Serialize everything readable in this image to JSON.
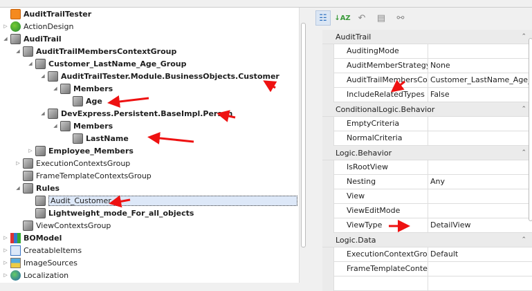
{
  "tree": {
    "nodes": [
      {
        "label": "AuditTrailTester",
        "bold": true,
        "level": 0,
        "toggle": "",
        "icon": "app-icon"
      },
      {
        "label": "ActionDesign",
        "bold": false,
        "level": 0,
        "toggle": "collapsed",
        "icon": "action-design-icon"
      },
      {
        "label": "AudiTrail",
        "bold": true,
        "level": 0,
        "toggle": "expanded",
        "icon": "cube-icon"
      },
      {
        "label": "AuditTrailMembersContextGroup",
        "bold": true,
        "level": 1,
        "toggle": "expanded",
        "icon": "cube-icon"
      },
      {
        "label": "Customer_LastName_Age_Group",
        "bold": true,
        "level": 2,
        "toggle": "expanded",
        "icon": "cube-icon"
      },
      {
        "label": "AuditTrailTester.Module.BusinessObjects.Customer",
        "bold": true,
        "level": 3,
        "toggle": "expanded",
        "icon": "cube-icon"
      },
      {
        "label": "Members",
        "bold": true,
        "level": 4,
        "toggle": "expanded",
        "icon": "cube-icon"
      },
      {
        "label": "Age",
        "bold": true,
        "level": 5,
        "toggle": "",
        "icon": "cube-icon"
      },
      {
        "label": "DevExpress.Persistent.BaseImpl.Person",
        "bold": true,
        "level": 3,
        "toggle": "expanded",
        "icon": "cube-icon"
      },
      {
        "label": "Members",
        "bold": true,
        "level": 4,
        "toggle": "expanded",
        "icon": "cube-icon"
      },
      {
        "label": "LastName",
        "bold": true,
        "level": 5,
        "toggle": "",
        "icon": "cube-icon"
      },
      {
        "label": "Employee_Members",
        "bold": true,
        "level": 2,
        "toggle": "collapsed",
        "icon": "cube-icon"
      },
      {
        "label": "ExecutionContextsGroup",
        "bold": false,
        "level": 1,
        "toggle": "collapsed",
        "icon": "cube-icon"
      },
      {
        "label": "FrameTemplateContextsGroup",
        "bold": false,
        "level": 1,
        "toggle": "",
        "icon": "cube-icon"
      },
      {
        "label": "Rules",
        "bold": true,
        "level": 1,
        "toggle": "expanded",
        "icon": "cube-icon"
      },
      {
        "label": "Audit_Customer",
        "bold": false,
        "level": 2,
        "toggle": "",
        "icon": "cube-icon",
        "selected": true
      },
      {
        "label": "Lightweight_mode_For_all_objects",
        "bold": true,
        "level": 2,
        "toggle": "",
        "icon": "cube-icon"
      },
      {
        "label": "ViewContextsGroup",
        "bold": false,
        "level": 1,
        "toggle": "",
        "icon": "cube-icon"
      },
      {
        "label": "BOModel",
        "bold": true,
        "level": 0,
        "toggle": "collapsed",
        "icon": "bo-model-icon"
      },
      {
        "label": "CreatableItems",
        "bold": false,
        "level": 0,
        "toggle": "collapsed",
        "icon": "creatable-items-icon"
      },
      {
        "label": "ImageSources",
        "bold": false,
        "level": 0,
        "toggle": "collapsed",
        "icon": "image-sources-icon"
      },
      {
        "label": "Localization",
        "bold": false,
        "level": 0,
        "toggle": "collapsed",
        "icon": "globe-icon"
      }
    ]
  },
  "toolbar": {
    "buttons": [
      "categorized-icon",
      "sort-az-icon",
      "undo-icon",
      "property-pages-icon",
      "link-icon"
    ]
  },
  "properties": [
    {
      "category": "AuditTrail",
      "rows": [
        {
          "name": "AuditingMode",
          "value": ""
        },
        {
          "name": "AuditMemberStrategy",
          "value": "None"
        },
        {
          "name": "AuditTrailMembersConte",
          "value": "Customer_LastName_Age_..."
        },
        {
          "name": "IncludeRelatedTypes",
          "value": "False"
        }
      ]
    },
    {
      "category": "ConditionalLogic.Behavior",
      "rows": [
        {
          "name": "EmptyCriteria",
          "value": ""
        },
        {
          "name": "NormalCriteria",
          "value": ""
        }
      ]
    },
    {
      "category": "Logic.Behavior",
      "rows": [
        {
          "name": "IsRootView",
          "value": ""
        },
        {
          "name": "Nesting",
          "value": "Any"
        },
        {
          "name": "View",
          "value": ""
        },
        {
          "name": "ViewEditMode",
          "value": ""
        },
        {
          "name": "ViewType",
          "value": "DetailView"
        }
      ]
    },
    {
      "category": "Logic.Data",
      "rows": [
        {
          "name": "ExecutionContextGroup",
          "value": "Default"
        },
        {
          "name": "FrameTemplateContextG",
          "value": ""
        },
        {
          "name": "",
          "value": ""
        }
      ]
    }
  ],
  "annotation_color": "#ee1111"
}
